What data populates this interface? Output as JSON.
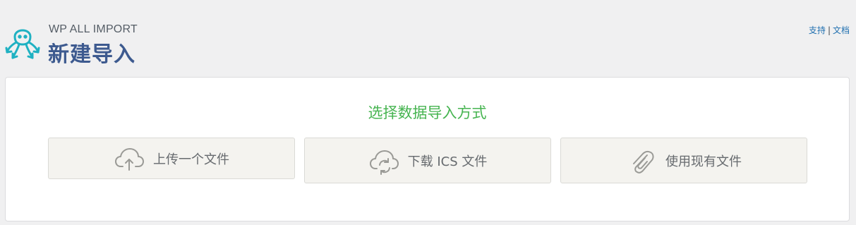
{
  "header": {
    "brand": "WP ALL IMPORT",
    "title": "新建导入",
    "links": {
      "support": "支持",
      "separator": "|",
      "docs": "文档"
    },
    "logo_icon": "octopus-logo-icon"
  },
  "panel": {
    "heading": "选择数据导入方式",
    "options": [
      {
        "label": "上传一个文件",
        "icon": "cloud-upload-icon"
      },
      {
        "label": "下载 ICS 文件",
        "icon": "cloud-sync-icon"
      },
      {
        "label": "使用现有文件",
        "icon": "paperclip-icon"
      }
    ]
  },
  "colors": {
    "background": "#f0f0f1",
    "title": "#3d5a8f",
    "heading": "#46b450",
    "link": "#2271b1",
    "logo": "#1fb1c2",
    "option_bg": "#f4f3ef"
  }
}
